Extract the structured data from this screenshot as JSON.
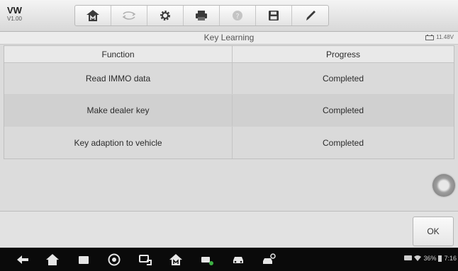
{
  "app": {
    "name": "VW",
    "version": "V1.00"
  },
  "toolbar": {
    "buttons": [
      {
        "icon": "home-icon"
      },
      {
        "icon": "vehicle-swap-icon"
      },
      {
        "icon": "settings-gear-icon"
      },
      {
        "icon": "print-icon"
      },
      {
        "icon": "help-icon"
      },
      {
        "icon": "save-icon"
      },
      {
        "icon": "pen-icon"
      }
    ]
  },
  "title": "Key Learning",
  "voltage": "11.48V",
  "table": {
    "headers": {
      "function": "Function",
      "progress": "Progress"
    },
    "rows": [
      {
        "function": "Read IMMO data",
        "progress": "Completed"
      },
      {
        "function": "Make dealer key",
        "progress": "Completed"
      },
      {
        "function": "Key adaption to vehicle",
        "progress": "Completed"
      }
    ]
  },
  "actions": {
    "ok_label": "OK"
  },
  "status": {
    "battery": "36%",
    "time": "7:16"
  },
  "colors": {
    "nav_bar": "#0a0a0a",
    "toolbar_bg": "#e0e0e0",
    "row_alt": "#d0d0d0"
  }
}
